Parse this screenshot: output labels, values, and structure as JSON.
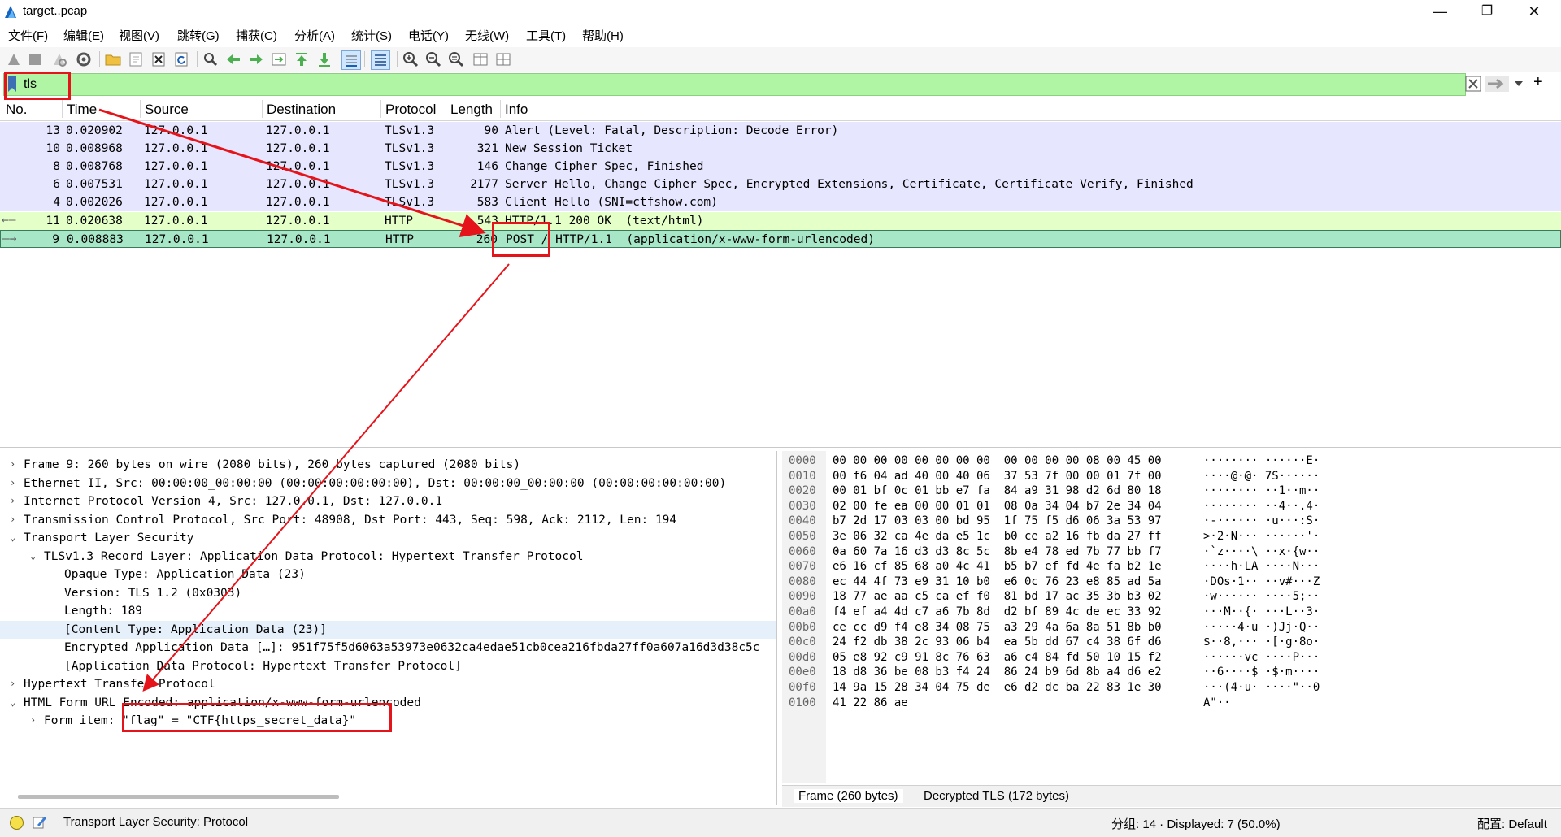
{
  "window": {
    "title": "target..pcap",
    "minimize": "—",
    "maximize": "❐",
    "close": "✕"
  },
  "menu": [
    "文件(F)",
    "编辑(E)",
    "视图(V)",
    "跳转(G)",
    "捕获(C)",
    "分析(A)",
    "统计(S)",
    "电话(Y)",
    "无线(W)",
    "工具(T)",
    "帮助(H)"
  ],
  "filter": {
    "value": "tls",
    "add_button": "+"
  },
  "packet_list": {
    "columns": [
      "No.",
      "Time",
      "Source",
      "Destination",
      "Protocol",
      "Length",
      "Info"
    ],
    "rows": [
      {
        "no": "13",
        "time": "0.020902",
        "src": "127.0.0.1",
        "dst": "127.0.0.1",
        "proto": "TLSv1.3",
        "len": "90",
        "info": "Alert (Level: Fatal, Description: Decode Error)",
        "color": "#e7e6ff"
      },
      {
        "no": "10",
        "time": "0.008968",
        "src": "127.0.0.1",
        "dst": "127.0.0.1",
        "proto": "TLSv1.3",
        "len": "321",
        "info": "New Session Ticket",
        "color": "#e7e6ff"
      },
      {
        "no": "8",
        "time": "0.008768",
        "src": "127.0.0.1",
        "dst": "127.0.0.1",
        "proto": "TLSv1.3",
        "len": "146",
        "info": "Change Cipher Spec, Finished",
        "color": "#e7e6ff"
      },
      {
        "no": "6",
        "time": "0.007531",
        "src": "127.0.0.1",
        "dst": "127.0.0.1",
        "proto": "TLSv1.3",
        "len": "2177",
        "info": "Server Hello, Change Cipher Spec, Encrypted Extensions, Certificate, Certificate Verify, Finished",
        "color": "#e7e6ff"
      },
      {
        "no": "4",
        "time": "0.002026",
        "src": "127.0.0.1",
        "dst": "127.0.0.1",
        "proto": "TLSv1.3",
        "len": "583",
        "info": "Client Hello (SNI=ctfshow.com)",
        "color": "#e7e6ff"
      },
      {
        "no": "11",
        "time": "0.020638",
        "src": "127.0.0.1",
        "dst": "127.0.0.1",
        "proto": "HTTP",
        "len": "543",
        "info": "HTTP/1.1 200 OK  (text/html)",
        "color": "#e4ffc7"
      },
      {
        "no": "9",
        "time": "0.008883",
        "src": "127.0.0.1",
        "dst": "127.0.0.1",
        "proto": "HTTP",
        "len": "260",
        "info": "POST / HTTP/1.1  (application/x-www-form-urlencoded)",
        "color": "#a8e6c8"
      }
    ]
  },
  "details": [
    {
      "indent": 0,
      "tw": "›",
      "text": "Frame 9: 260 bytes on wire (2080 bits), 260 bytes captured (2080 bits)"
    },
    {
      "indent": 0,
      "tw": "›",
      "text": "Ethernet II, Src: 00:00:00_00:00:00 (00:00:00:00:00:00), Dst: 00:00:00_00:00:00 (00:00:00:00:00:00)"
    },
    {
      "indent": 0,
      "tw": "›",
      "text": "Internet Protocol Version 4, Src: 127.0.0.1, Dst: 127.0.0.1"
    },
    {
      "indent": 0,
      "tw": "›",
      "text": "Transmission Control Protocol, Src Port: 48908, Dst Port: 443, Seq: 598, Ack: 2112, Len: 194"
    },
    {
      "indent": 0,
      "tw": "⌄",
      "text": "Transport Layer Security"
    },
    {
      "indent": 1,
      "tw": "⌄",
      "text": "TLSv1.3 Record Layer: Application Data Protocol: Hypertext Transfer Protocol"
    },
    {
      "indent": 2,
      "tw": "",
      "text": "Opaque Type: Application Data (23)"
    },
    {
      "indent": 2,
      "tw": "",
      "text": "Version: TLS 1.2 (0x0303)"
    },
    {
      "indent": 2,
      "tw": "",
      "text": "Length: 189"
    },
    {
      "indent": 2,
      "tw": "",
      "text": "[Content Type: Application Data (23)]"
    },
    {
      "indent": 2,
      "tw": "",
      "text": "Encrypted Application Data […]: 951f75f5d6063a53973e0632ca4edae51cb0cea216fbda27ff0a607a16d3d38c5c"
    },
    {
      "indent": 2,
      "tw": "",
      "text": "[Application Data Protocol: Hypertext Transfer Protocol]"
    },
    {
      "indent": 0,
      "tw": "›",
      "text": "Hypertext Transfer Protocol"
    },
    {
      "indent": 0,
      "tw": "⌄",
      "text": "HTML Form URL Encoded: application/x-www-form-urlencoded"
    },
    {
      "indent": 1,
      "tw": "›",
      "text": "Form item: \"flag\" = \"CTF{https_secret_data}\""
    }
  ],
  "bytes": [
    {
      "off": "0000",
      "hex": "00 00 00 00 00 00 00 00  00 00 00 00 08 00 45 00",
      "ascii": "········ ······E·"
    },
    {
      "off": "0010",
      "hex": "00 f6 04 ad 40 00 40 06  37 53 7f 00 00 01 7f 00",
      "ascii": "····@·@· 7S······"
    },
    {
      "off": "0020",
      "hex": "00 01 bf 0c 01 bb e7 fa  84 a9 31 98 d2 6d 80 18",
      "ascii": "········ ··1··m··"
    },
    {
      "off": "0030",
      "hex": "02 00 fe ea 00 00 01 01  08 0a 34 04 b7 2e 34 04",
      "ascii": "········ ··4··.4·"
    },
    {
      "off": "0040",
      "hex": "b7 2d 17 03 03 00 bd 95  1f 75 f5 d6 06 3a 53 97",
      "ascii": "·-······ ·u···:S·"
    },
    {
      "off": "0050",
      "hex": "3e 06 32 ca 4e da e5 1c  b0 ce a2 16 fb da 27 ff",
      "ascii": ">·2·N··· ······'·"
    },
    {
      "off": "0060",
      "hex": "0a 60 7a 16 d3 d3 8c 5c  8b e4 78 ed 7b 77 bb f7",
      "ascii": "·`z····\\ ··x·{w··"
    },
    {
      "off": "0070",
      "hex": "e6 16 cf 85 68 a0 4c 41  b5 b7 ef fd 4e fa b2 1e",
      "ascii": "····h·LA ····N···"
    },
    {
      "off": "0080",
      "hex": "ec 44 4f 73 e9 31 10 b0  e6 0c 76 23 e8 85 ad 5a",
      "ascii": "·DOs·1·· ··v#···Z"
    },
    {
      "off": "0090",
      "hex": "18 77 ae aa c5 ca ef f0  81 bd 17 ac 35 3b b3 02",
      "ascii": "·w······ ····5;··"
    },
    {
      "off": "00a0",
      "hex": "f4 ef a4 4d c7 a6 7b 8d  d2 bf 89 4c de ec 33 92",
      "ascii": "···M··{· ···L··3·"
    },
    {
      "off": "00b0",
      "hex": "ce cc d9 f4 e8 34 08 75  a3 29 4a 6a 8a 51 8b b0",
      "ascii": "·····4·u ·)Jj·Q··"
    },
    {
      "off": "00c0",
      "hex": "24 f2 db 38 2c 93 06 b4  ea 5b dd 67 c4 38 6f d6",
      "ascii": "$··8,··· ·[·g·8o·"
    },
    {
      "off": "00d0",
      "hex": "05 e8 92 c9 91 8c 76 63  a6 c4 84 fd 50 10 15 f2",
      "ascii": "······vc ····P···"
    },
    {
      "off": "00e0",
      "hex": "18 d8 36 be 08 b3 f4 24  86 24 b9 6d 8b a4 d6 e2",
      "ascii": "··6····$ ·$·m····"
    },
    {
      "off": "00f0",
      "hex": "14 9a 15 28 34 04 75 de  e6 d2 dc ba 22 83 1e 30",
      "ascii": "···(4·u· ····\"··0"
    },
    {
      "off": "0100",
      "hex": "41 22 86 ae",
      "ascii": "A\"··"
    }
  ],
  "byte_tabs": [
    "Frame (260 bytes)",
    "Decrypted TLS (172 bytes)"
  ],
  "status": {
    "field": "Transport Layer Security: Protocol",
    "packets": "分组: 14 · Displayed: 7 (50.0%)",
    "profile": "配置: Default"
  },
  "colors": {
    "annotation_red": "#e5141a",
    "filter_ok": "#aff5a4",
    "selected_row": "#a8e6c8"
  }
}
